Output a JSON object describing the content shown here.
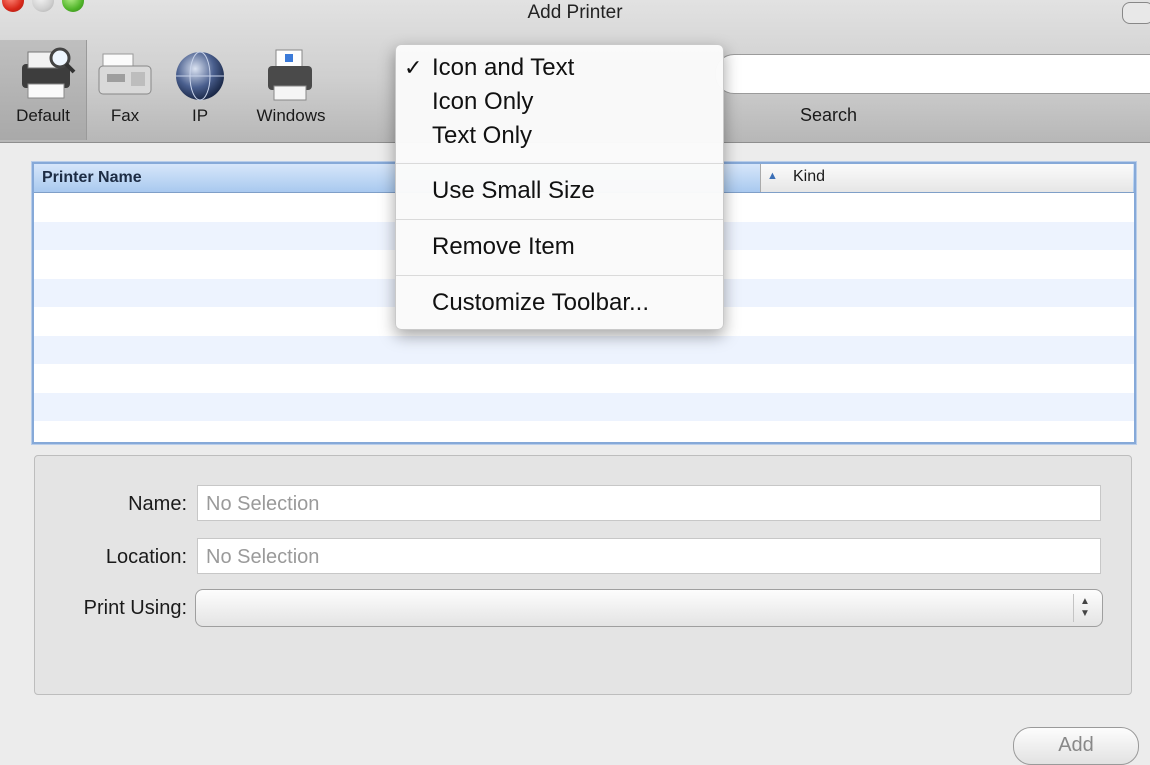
{
  "window": {
    "title": "Add Printer"
  },
  "toolbar": {
    "items": [
      {
        "label": "Default",
        "icon": "printer-magnifier-icon"
      },
      {
        "label": "Fax",
        "icon": "fax-icon"
      },
      {
        "label": "IP",
        "icon": "globe-icon"
      },
      {
        "label": "Windows",
        "icon": "windows-printer-icon"
      }
    ],
    "search_label": "Search"
  },
  "list": {
    "columns": [
      {
        "label": "Printer Name"
      },
      {
        "label": "Kind",
        "sort": "ascending"
      }
    ],
    "rows": []
  },
  "info": {
    "name_label": "Name:",
    "name_value": "No Selection",
    "location_label": "Location:",
    "location_value": "No Selection",
    "print_using_label": "Print Using:",
    "print_using_value": ""
  },
  "add_label": "Add",
  "context_menu": {
    "items": [
      {
        "label": "Icon and Text",
        "checked": true
      },
      {
        "label": "Icon Only",
        "checked": false
      },
      {
        "label": "Text Only",
        "checked": false
      },
      {
        "label": "Use Small Size",
        "checked": false
      },
      {
        "label": "Remove Item",
        "checked": false
      },
      {
        "label": "Customize Toolbar...",
        "checked": false
      }
    ],
    "checkmark": "✓"
  },
  "colors": {
    "list_focus": "#86a9d8",
    "row_alt": "#edf3fe",
    "close_button": "#d8281a",
    "zoom_button": "#51b52a"
  }
}
